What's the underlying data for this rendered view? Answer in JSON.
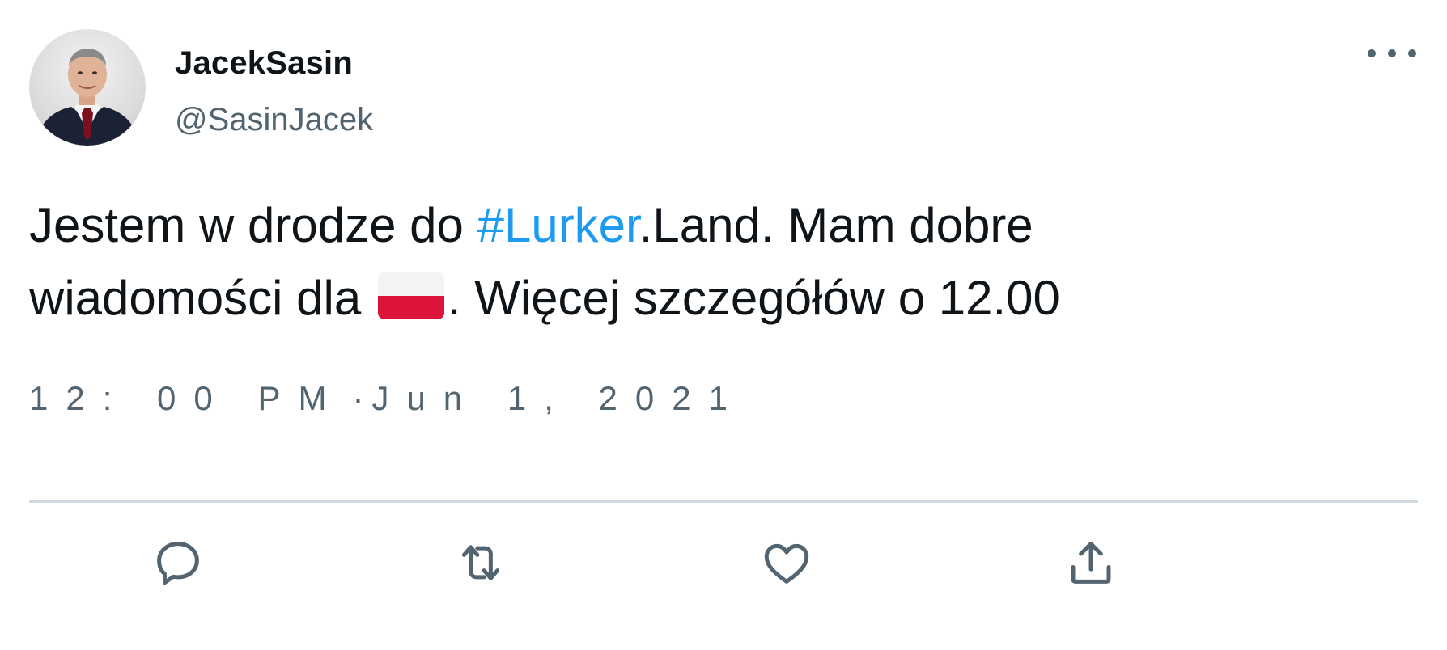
{
  "tweet": {
    "author": {
      "display_name": "JacekSasin",
      "handle": "@SasinJacek"
    },
    "text": {
      "part1": "Jestem w drodze do ",
      "hashtag": "#Lurker",
      "part2": ".Land. Mam dobre wiadomości dla ",
      "flag_emoji": "🇵🇱",
      "part3": ". Więcej szczegółów o 12.00"
    },
    "time": "12: 00 PM",
    "separator": "·",
    "date": "Jun 1, 2021"
  },
  "icons": {
    "more": "more-horizontal-icon",
    "reply": "reply-icon",
    "retweet": "retweet-icon",
    "like": "heart-icon",
    "share": "share-icon"
  },
  "colors": {
    "text": "#0f1419",
    "secondary": "#536471",
    "link": "#1d9bf0",
    "divider": "#cfd9de",
    "flag_red": "#dc143c"
  }
}
